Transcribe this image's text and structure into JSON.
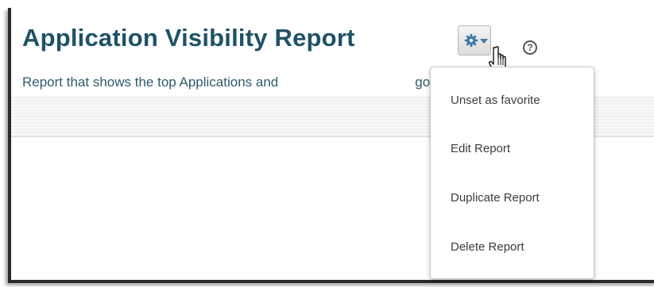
{
  "header": {
    "title": "Application Visibility Report",
    "subtitle_left": "Report that shows the top Applications and",
    "subtitle_right": "gories"
  },
  "actions": {
    "gear_icon": "gear-icon",
    "caret_icon": "caret-down-icon",
    "help_icon": "question-circle-icon",
    "help_glyph": "?"
  },
  "menu": {
    "items": [
      {
        "label": "Unset as favorite"
      },
      {
        "label": "Edit Report"
      },
      {
        "label": "Duplicate Report"
      },
      {
        "label": "Delete Report"
      }
    ]
  },
  "colors": {
    "title": "#1e5266",
    "subtitle": "#2e5b6d",
    "accent": "#3a78a8"
  }
}
